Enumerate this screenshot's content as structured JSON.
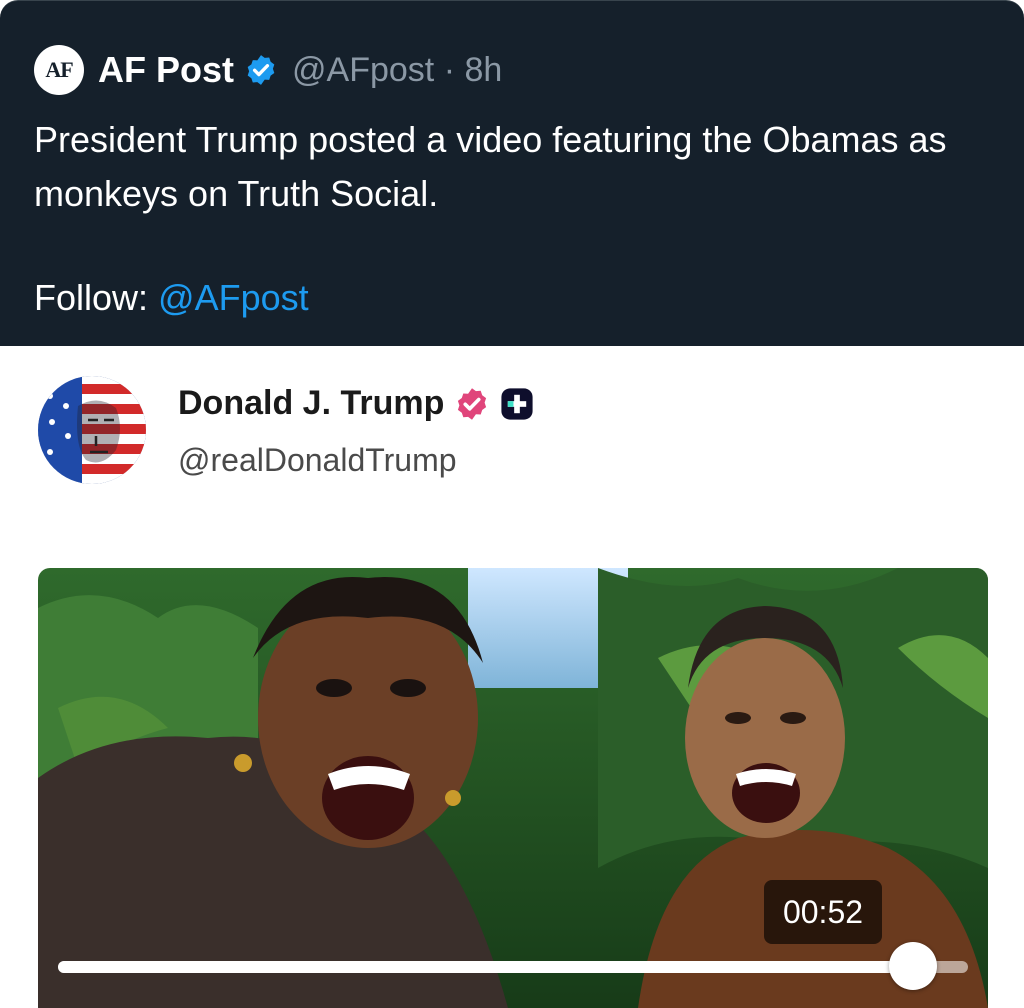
{
  "tweet": {
    "logo_text": "AF",
    "author_name": "AF Post",
    "handle_time": "@AFpost · 8h",
    "text": "President Trump posted a video featuring the Obamas as monkeys on Truth Social.",
    "follow_label": "Follow:",
    "follow_mention": "@AFpost",
    "verified_color": "#1d9bf0"
  },
  "truth_post": {
    "author_name": "Donald J. Trump",
    "handle": "@realDonaldTrump",
    "verified_color": "#e0457b",
    "video": {
      "timestamp": "00:52",
      "progress": 0.94
    }
  },
  "icons": {
    "verified": "verified-badge-icon",
    "plus": "truth-plus-icon"
  }
}
